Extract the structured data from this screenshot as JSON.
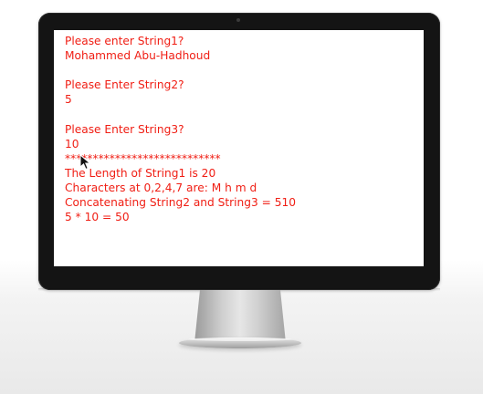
{
  "console": {
    "lines": [
      "Please enter String1?",
      "Mohammed Abu-Hadhoud",
      "",
      "Please Enter String2?",
      "5",
      "",
      "Please Enter String3?",
      "10",
      "****************************",
      "The Length of String1 is 20",
      "Characters at 0,2,4,7 are: M h m d",
      "Concatenating String2 and String3 = 510",
      "5 * 10 = 50"
    ],
    "text_color": "#f01e14"
  },
  "icons": {
    "cursor": "mouse-pointer-icon"
  }
}
